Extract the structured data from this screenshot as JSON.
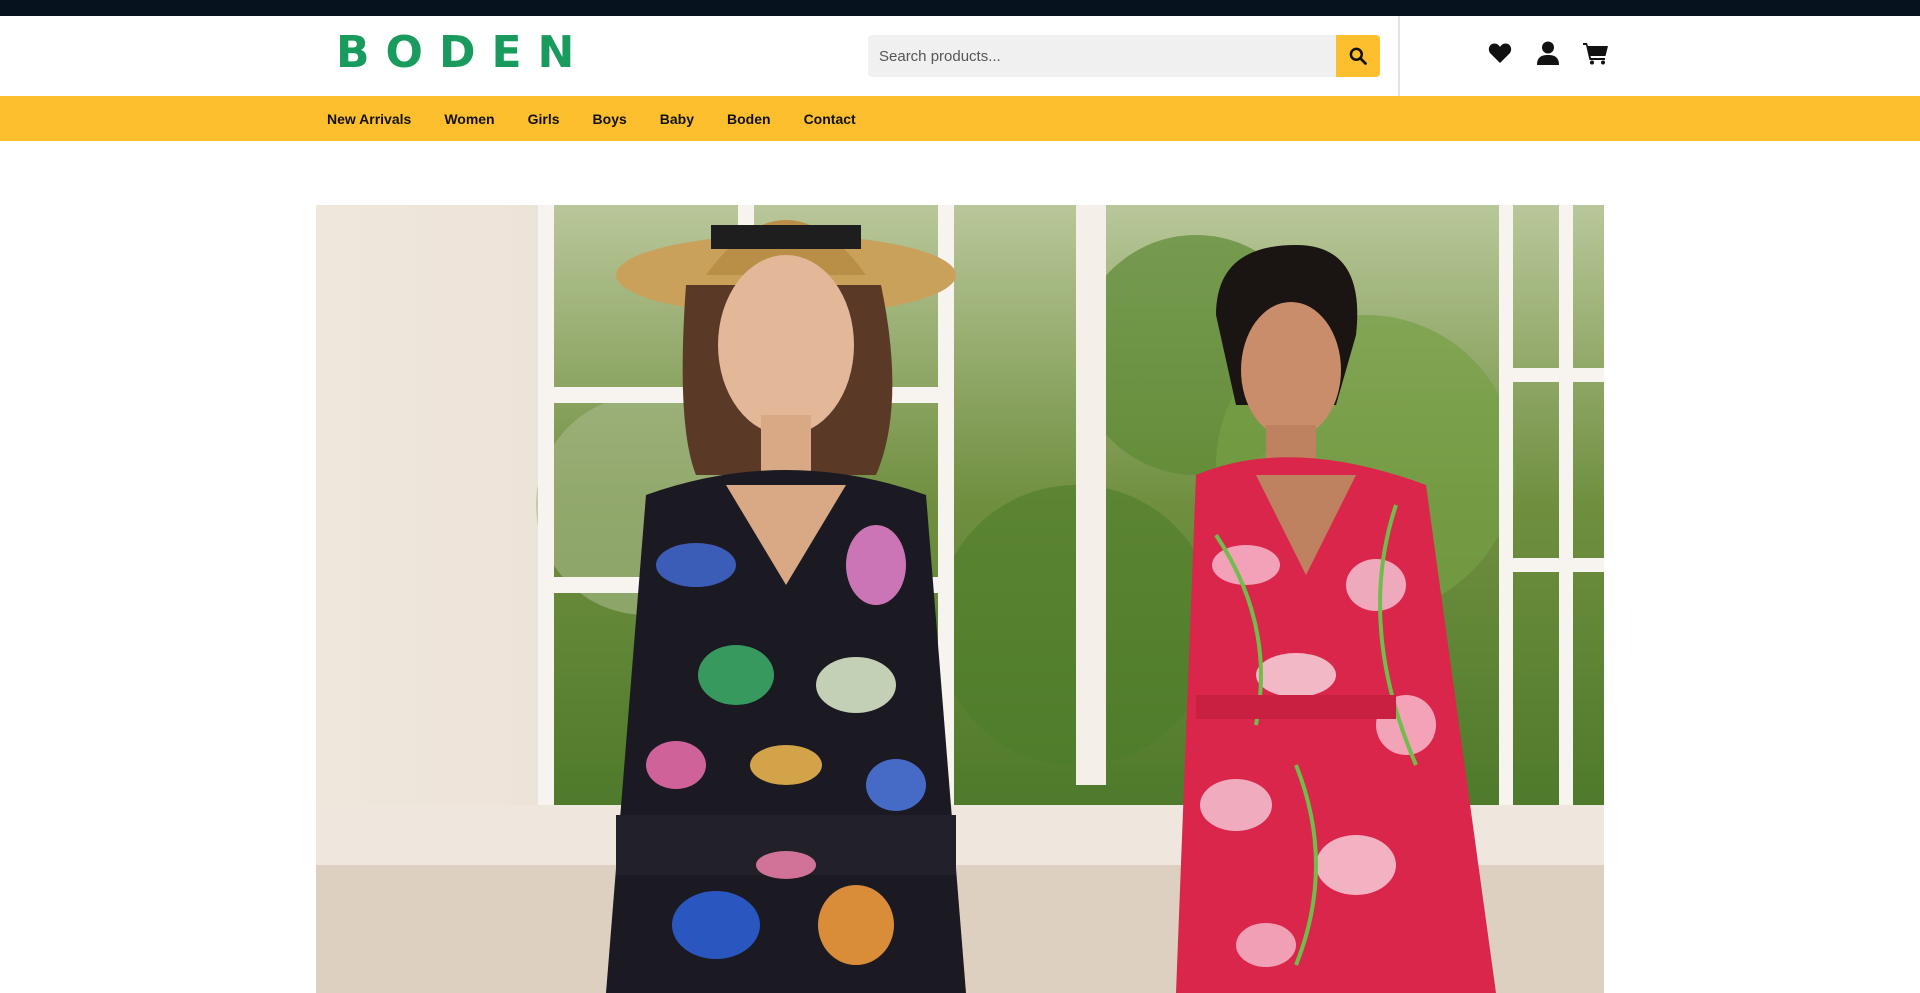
{
  "brand": {
    "logo_text": "BODEN",
    "logo_color": "#1a9b5e"
  },
  "search": {
    "placeholder": "Search products...",
    "value": "",
    "button_icon": "search-icon"
  },
  "header_icons": [
    {
      "name": "wishlist",
      "icon": "heart-icon"
    },
    {
      "name": "account",
      "icon": "user-icon"
    },
    {
      "name": "cart",
      "icon": "cart-icon"
    }
  ],
  "nav": {
    "items": [
      {
        "label": "New Arrivals"
      },
      {
        "label": "Women"
      },
      {
        "label": "Girls"
      },
      {
        "label": "Boys"
      },
      {
        "label": "Baby"
      },
      {
        "label": "Boden"
      },
      {
        "label": "Contact"
      }
    ]
  },
  "colors": {
    "topbar": "#06131f",
    "accent": "#fdbf2d",
    "brand_green": "#1a9b5e"
  },
  "hero": {
    "image": "hero-fashion-photo"
  }
}
